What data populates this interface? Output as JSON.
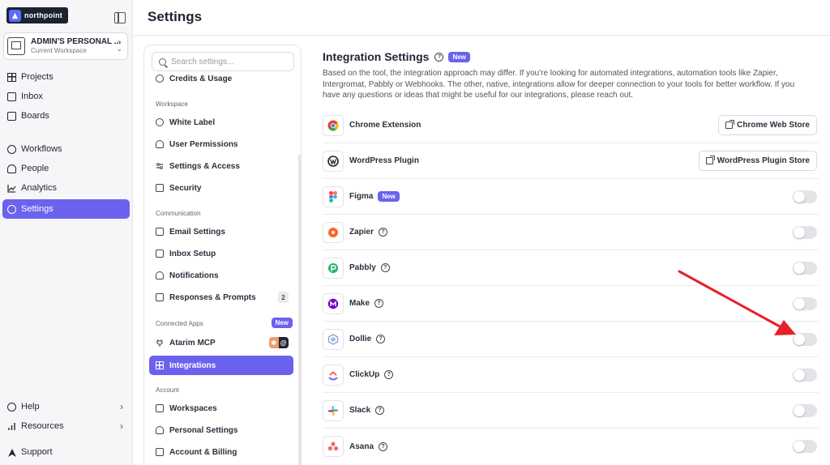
{
  "app": {
    "logo_text": "northpoint",
    "page_title": "Settings"
  },
  "workspace": {
    "name": "ADMIN'S PERSONAL ...",
    "subtitle": "Current Workspace"
  },
  "sidebar": {
    "items": [
      {
        "label": "Projects",
        "icon": "grid-icon"
      },
      {
        "label": "Inbox",
        "icon": "inbox-icon"
      },
      {
        "label": "Boards",
        "icon": "board-icon"
      },
      {
        "label": "Workflows",
        "icon": "workflow-icon"
      },
      {
        "label": "People",
        "icon": "person-icon"
      },
      {
        "label": "Analytics",
        "icon": "analytics-icon"
      },
      {
        "label": "Settings",
        "icon": "gear-icon"
      }
    ],
    "bottom": [
      {
        "label": "Help",
        "icon": "help-icon"
      },
      {
        "label": "Resources",
        "icon": "bar-chart-icon"
      },
      {
        "label": "Support",
        "icon": "brand-icon"
      }
    ]
  },
  "settings_nav": {
    "search_placeholder": "Search settings...",
    "credits": "Credits & Usage",
    "sections": {
      "workspace": "Workspace",
      "communication": "Communication",
      "connected_apps": "Connected Apps",
      "account": "Account"
    },
    "workspace_items": [
      "White Label",
      "User Permissions",
      "Settings & Access",
      "Security"
    ],
    "communication_items": [
      "Email Settings",
      "Inbox Setup",
      "Notifications",
      "Responses & Prompts"
    ],
    "responses_count": "2",
    "connected_new": "New",
    "connected_items": [
      "Atarim MCP",
      "Integrations"
    ],
    "account_items": [
      "Workspaces",
      "Personal Settings",
      "Account & Billing"
    ]
  },
  "main": {
    "title": "Integration Settings",
    "new_badge": "New",
    "description": "Based on the tool, the integration approach may differ. If you're looking for automated integrations, automation tools like Zapier, Intergromat, Pabbly or Webhooks. The other, native, integrations allow for deeper connection to your tools for better workflow. If you have any questions or ideas that might be useful for our integrations, please reach out.",
    "integrations": [
      {
        "name": "Chrome Extension",
        "action": "Chrome Web Store"
      },
      {
        "name": "WordPress Plugin",
        "action": "WordPress Plugin Store"
      },
      {
        "name": "Figma",
        "badge": "New",
        "enabled": false
      },
      {
        "name": "Zapier",
        "enabled": false
      },
      {
        "name": "Pabbly",
        "enabled": false
      },
      {
        "name": "Make",
        "enabled": false
      },
      {
        "name": "Dollie",
        "enabled": false
      },
      {
        "name": "ClickUp",
        "enabled": false
      },
      {
        "name": "Slack",
        "enabled": false
      },
      {
        "name": "Asana",
        "enabled": false
      }
    ]
  },
  "colors": {
    "accent": "#6b62ee",
    "annotation_arrow": "#e8202a"
  }
}
